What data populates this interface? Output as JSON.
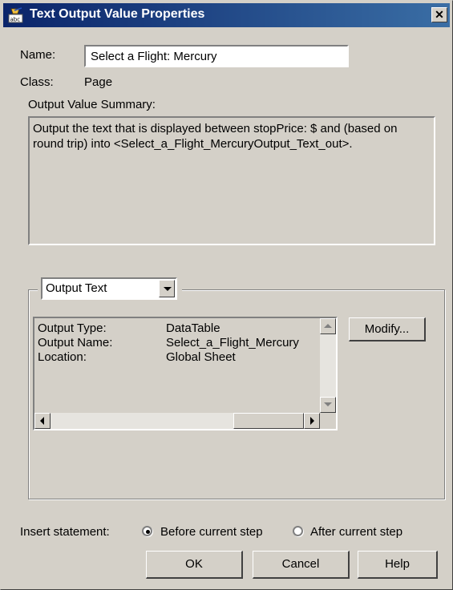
{
  "window": {
    "title": "Text Output Value Properties",
    "close_glyph": "✕"
  },
  "fields": {
    "name_label": "Name:",
    "name_value": "Select a Flight: Mercury",
    "class_label": "Class:",
    "class_value": "Page",
    "summary_label": "Output Value Summary:",
    "summary_text": "Output the text that is displayed between stopPrice: $ and  (based on round trip)  into <Select_a_Flight_MercuryOutput_Text_out>."
  },
  "output_group": {
    "dropdown_value": "Output Text",
    "rows": [
      {
        "label": "Output Type:",
        "value": "DataTable"
      },
      {
        "label": "Output Name:",
        "value": "Select_a_Flight_Mercury"
      },
      {
        "label": "Location:",
        "value": "Global Sheet"
      }
    ],
    "modify_label": "Modify..."
  },
  "insert": {
    "label": "Insert statement:",
    "options": [
      {
        "label": "Before current step",
        "selected": true
      },
      {
        "label": "After current step",
        "selected": false
      }
    ]
  },
  "buttons": {
    "ok": "OK",
    "cancel": "Cancel",
    "help": "Help"
  },
  "colors": {
    "title_start": "#0a246a",
    "title_end": "#3a6ea5",
    "face": "#d4d0c8"
  }
}
